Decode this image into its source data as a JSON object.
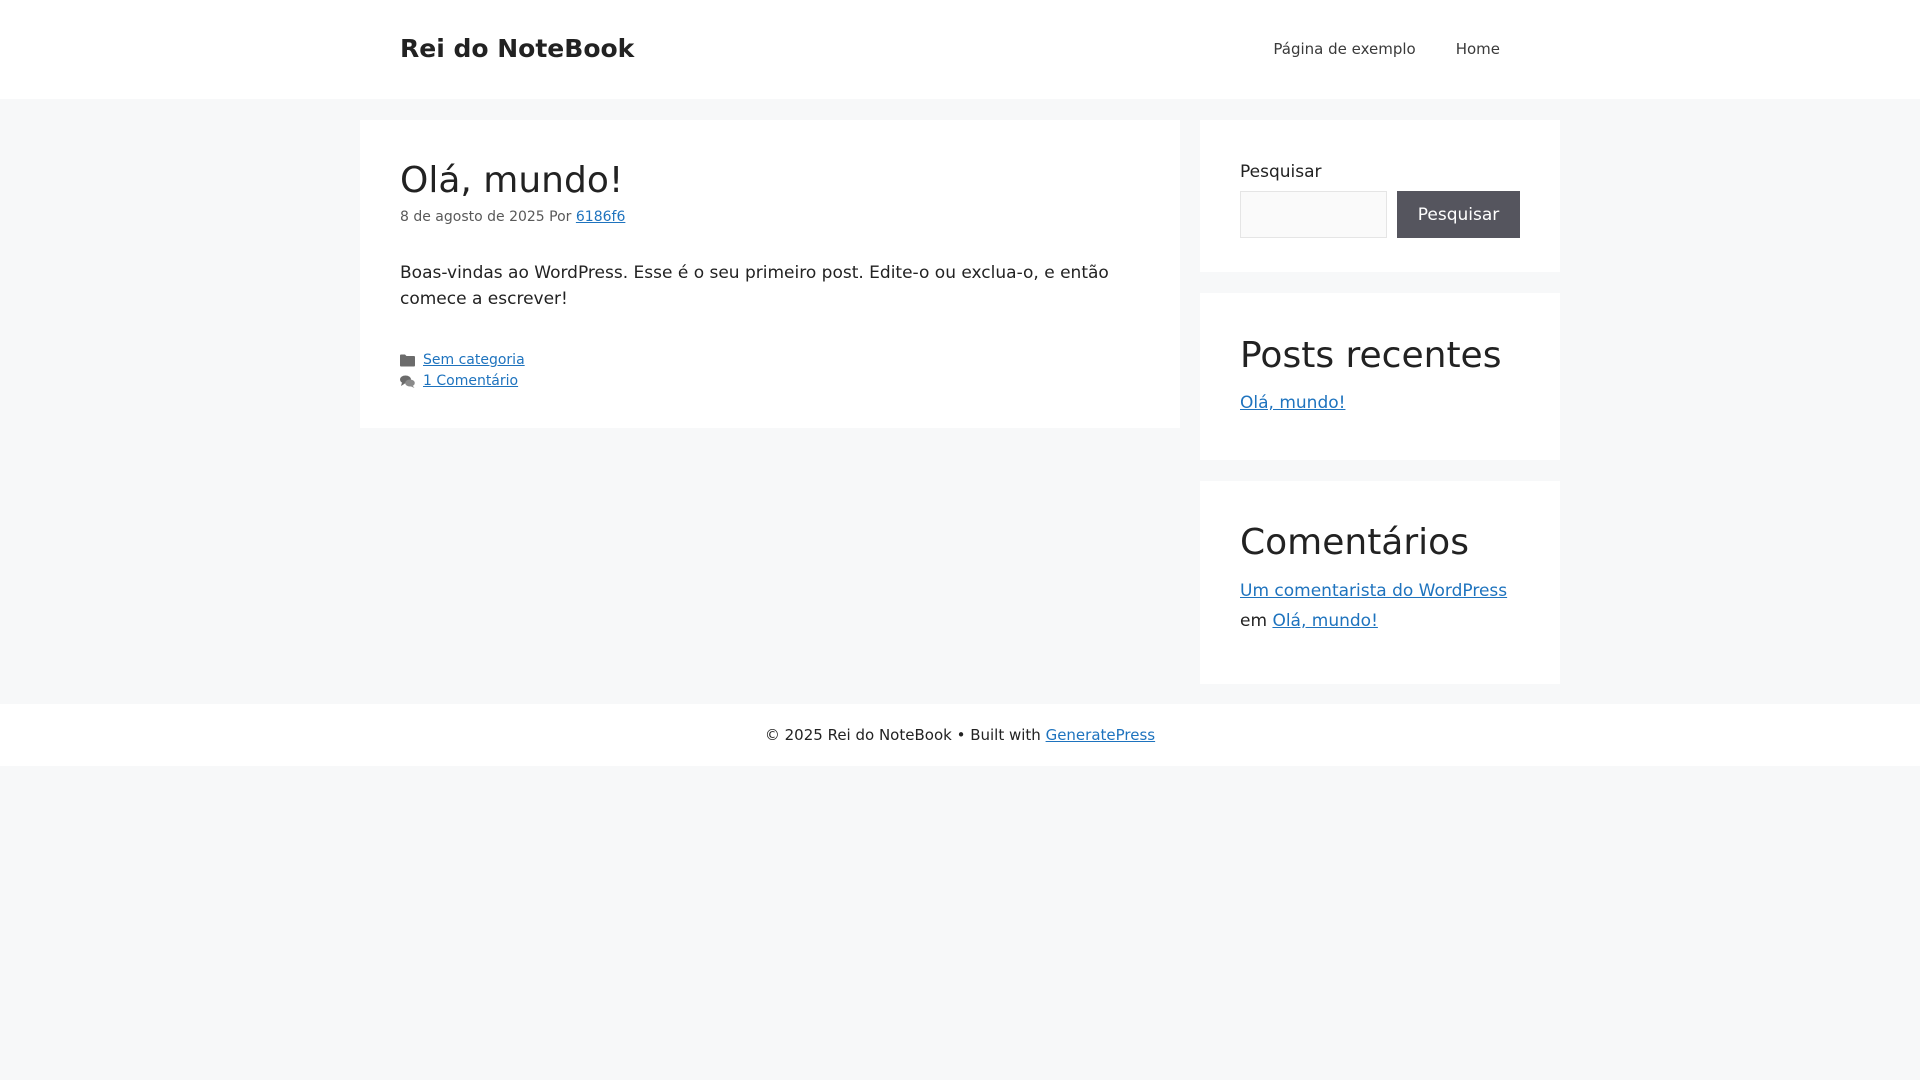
{
  "header": {
    "site_title": "Rei do NoteBook",
    "nav": [
      {
        "label": "Página de exemplo"
      },
      {
        "label": "Home"
      }
    ]
  },
  "post": {
    "title": "Olá, mundo!",
    "date": "8 de agosto de 2025",
    "by": "Por",
    "author": "6186f6",
    "content": "Boas-vindas ao WordPress. Esse é o seu primeiro post. Edite-o ou exclua-o, e então comece a escrever!",
    "category": "Sem categoria",
    "comments": "1 Comentário",
    "category_icon": "folder-icon",
    "comments_icon": "comments-icon"
  },
  "sidebar": {
    "search": {
      "label": "Pesquisar",
      "value": "",
      "button": "Pesquisar"
    },
    "recent_posts": {
      "title": "Posts recentes",
      "items": [
        {
          "label": "Olá, mundo!"
        }
      ]
    },
    "recent_comments": {
      "title": "Comentários",
      "author": "Um comentarista do WordPress",
      "on": "em",
      "post": "Olá, mundo!"
    }
  },
  "footer": {
    "copyright": "© 2025 Rei do NoteBook • Built with",
    "link": "GeneratePress"
  },
  "colors": {
    "link": "#1e73be",
    "button_bg": "#55555e",
    "page_bg": "#f7f8f9"
  }
}
